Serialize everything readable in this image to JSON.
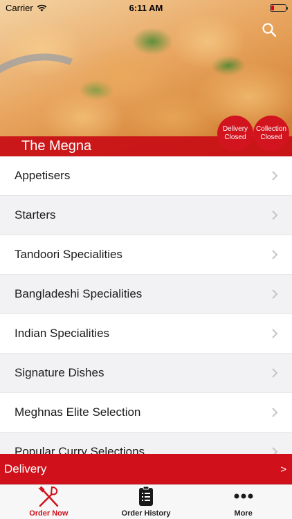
{
  "status_bar": {
    "carrier": "Carrier",
    "time": "6:11 AM"
  },
  "restaurant": {
    "name": "The Megna"
  },
  "badges": {
    "delivery": "Delivery Closed",
    "collection": "Collection Closed"
  },
  "menu": {
    "categories": [
      "Appetisers",
      "Starters",
      "Tandoori Specialities",
      "Bangladeshi Specialities",
      "Indian Specialities",
      "Signature Dishes",
      "Meghnas Elite Selection",
      "Popular Curry Selections"
    ]
  },
  "delivery_bar": {
    "label": "Delivery",
    "arrow": ">"
  },
  "tabs": [
    {
      "label": "Order Now",
      "icon": "fork-knife-icon",
      "active": true
    },
    {
      "label": "Order History",
      "icon": "clipboard-list-icon",
      "active": false
    },
    {
      "label": "More",
      "icon": "more-dots-icon",
      "active": false
    }
  ],
  "colors": {
    "accent": "#d0101a",
    "badge": "#d2141e",
    "tab_background": "#f7f7f7"
  }
}
